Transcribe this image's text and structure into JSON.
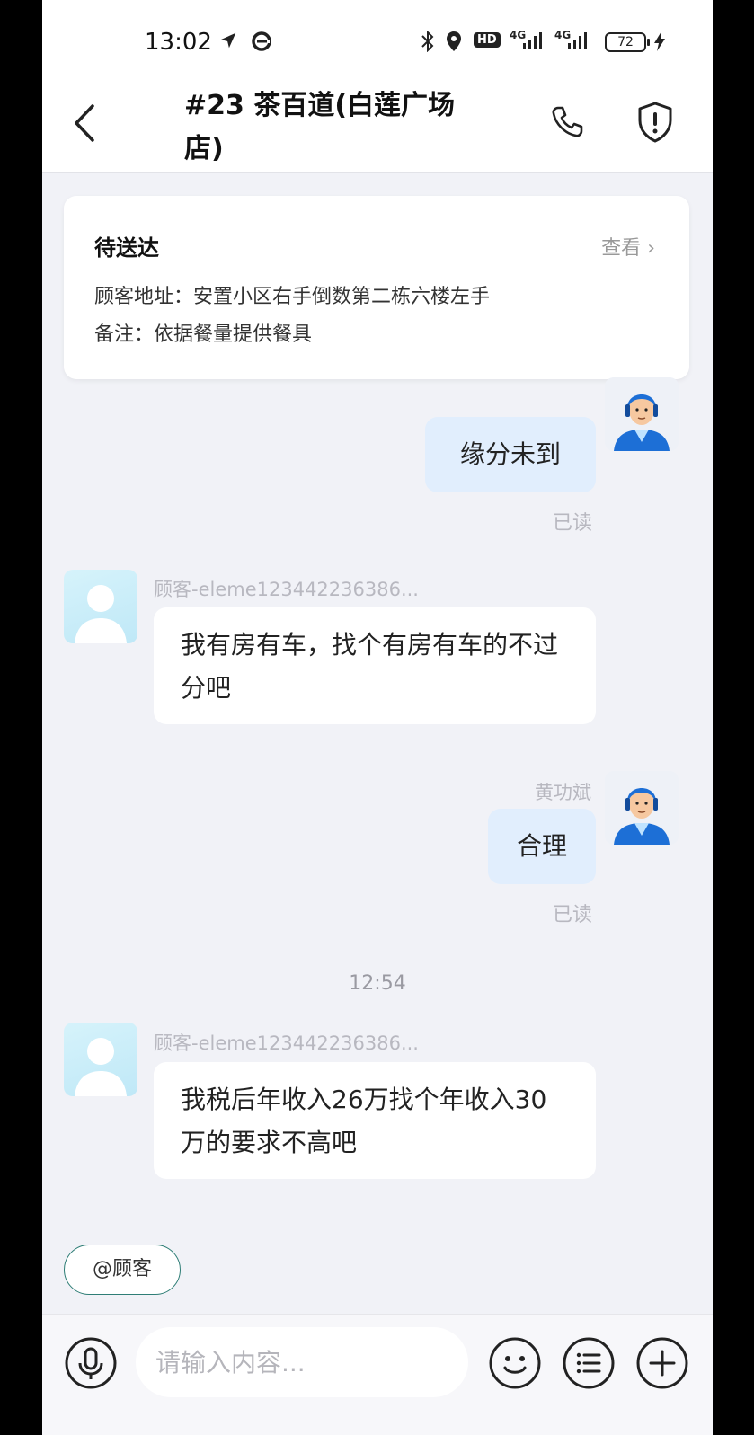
{
  "status_bar": {
    "time": "13:02",
    "network_label": "HD",
    "signal_1": "4G",
    "signal_2": "4G",
    "battery": "72"
  },
  "header": {
    "title": "#23 茶百道(白莲广场店)"
  },
  "order": {
    "status": "待送达",
    "view_label": "查看",
    "address_label": "顾客地址：",
    "address": "安置小区右手倒数第二栋六楼左手",
    "note_label": "备注：",
    "note": "依据餐量提供餐具"
  },
  "messages": [
    {
      "from": "rider",
      "sender": "",
      "text": "缘分未到",
      "read": "已读"
    },
    {
      "from": "customer",
      "sender": "顾客-eleme123442236386...",
      "text": "我有房有车，找个有房有车的不过分吧"
    },
    {
      "from": "rider",
      "sender": "黄功斌",
      "text": "合理",
      "read": "已读"
    },
    {
      "from": "customer",
      "sender": "顾客-eleme123442236386...",
      "text": "我税后年收入26万找个年收入30万的要求不高吧"
    }
  ],
  "timestamp": "12:54",
  "mention_chip": "@顾客",
  "input": {
    "placeholder": "请输入内容..."
  },
  "icons": {
    "back": "chevron-left-icon",
    "phone": "phone-icon",
    "shield": "shield-alert-icon",
    "voice": "microphone-icon",
    "emoji": "smiley-icon",
    "menu": "list-menu-icon",
    "plus": "plus-icon"
  },
  "colors": {
    "background": "#f1f2f7",
    "bubble_out": "#e1eefd",
    "bubble_in": "#ffffff",
    "chip_border": "#2f7e76"
  }
}
